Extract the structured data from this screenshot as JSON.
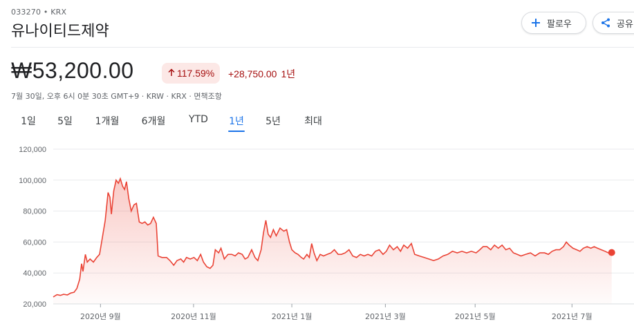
{
  "header": {
    "ticker": "033270 • KRX",
    "company": "유나이티드제약",
    "follow_label": "팔로우",
    "share_label": "공유"
  },
  "quote": {
    "price": "₩53,200.00",
    "change_pct": "117.59%",
    "change_abs": "+28,750.00",
    "change_period": "1년",
    "meta": "7월 30일, 오후 6시 0분 30초 GMT+9 · KRW · KRX · 면책조항"
  },
  "tabs": [
    {
      "label": "1일"
    },
    {
      "label": "5일"
    },
    {
      "label": "1개월"
    },
    {
      "label": "6개월"
    },
    {
      "label": "YTD"
    },
    {
      "label": "1년",
      "active": true
    },
    {
      "label": "5년"
    },
    {
      "label": "최대"
    }
  ],
  "colors": {
    "line": "#ea4335",
    "positive_bg": "#fce8e6",
    "positive_text": "#a50e0e",
    "accent": "#1a73e8"
  },
  "icons": {
    "follow": "plus-icon",
    "share": "share-icon"
  },
  "chart_data": {
    "type": "area",
    "x_range": [
      0,
      12
    ],
    "ylim": [
      20000,
      120000
    ],
    "yticks": [
      20000,
      40000,
      60000,
      80000,
      100000,
      120000
    ],
    "ytick_labels": [
      "20,000",
      "40,000",
      "60,000",
      "80,000",
      "100,000",
      "120,000"
    ],
    "xticks": [
      {
        "x": 1.0,
        "label": "2020년 9월"
      },
      {
        "x": 2.97,
        "label": "2020년 11월"
      },
      {
        "x": 5.05,
        "label": "2021년 1월"
      },
      {
        "x": 7.03,
        "label": "2021년 3월"
      },
      {
        "x": 8.93,
        "label": "2021년 5월"
      },
      {
        "x": 10.98,
        "label": "2021년 7월"
      }
    ],
    "points": [
      [
        0.0,
        24500
      ],
      [
        0.08,
        26000
      ],
      [
        0.15,
        25500
      ],
      [
        0.22,
        26200
      ],
      [
        0.3,
        25800
      ],
      [
        0.37,
        27000
      ],
      [
        0.44,
        27500
      ],
      [
        0.5,
        30000
      ],
      [
        0.56,
        36000
      ],
      [
        0.6,
        46000
      ],
      [
        0.63,
        41000
      ],
      [
        0.68,
        52000
      ],
      [
        0.72,
        47000
      ],
      [
        0.78,
        49000
      ],
      [
        0.85,
        47000
      ],
      [
        0.92,
        50000
      ],
      [
        0.98,
        52000
      ],
      [
        1.04,
        63000
      ],
      [
        1.1,
        74000
      ],
      [
        1.16,
        92000
      ],
      [
        1.2,
        89000
      ],
      [
        1.23,
        78000
      ],
      [
        1.28,
        93000
      ],
      [
        1.33,
        100000
      ],
      [
        1.38,
        98000
      ],
      [
        1.42,
        101000
      ],
      [
        1.47,
        96000
      ],
      [
        1.51,
        94000
      ],
      [
        1.55,
        99000
      ],
      [
        1.6,
        88000
      ],
      [
        1.65,
        80000
      ],
      [
        1.71,
        84000
      ],
      [
        1.76,
        85000
      ],
      [
        1.82,
        73000
      ],
      [
        1.88,
        72000
      ],
      [
        1.94,
        73000
      ],
      [
        2.0,
        71000
      ],
      [
        2.06,
        72000
      ],
      [
        2.12,
        76000
      ],
      [
        2.18,
        72000
      ],
      [
        2.22,
        51000
      ],
      [
        2.3,
        50000
      ],
      [
        2.4,
        50000
      ],
      [
        2.47,
        48000
      ],
      [
        2.55,
        45000
      ],
      [
        2.62,
        48000
      ],
      [
        2.7,
        49000
      ],
      [
        2.76,
        47000
      ],
      [
        2.82,
        50000
      ],
      [
        2.9,
        49000
      ],
      [
        2.98,
        50000
      ],
      [
        3.05,
        48000
      ],
      [
        3.12,
        52000
      ],
      [
        3.18,
        47000
      ],
      [
        3.25,
        44000
      ],
      [
        3.32,
        43000
      ],
      [
        3.38,
        45000
      ],
      [
        3.43,
        55000
      ],
      [
        3.5,
        53000
      ],
      [
        3.55,
        56000
      ],
      [
        3.62,
        49000
      ],
      [
        3.7,
        52000
      ],
      [
        3.78,
        52000
      ],
      [
        3.85,
        51000
      ],
      [
        3.92,
        53000
      ],
      [
        4.0,
        52000
      ],
      [
        4.06,
        49000
      ],
      [
        4.12,
        50000
      ],
      [
        4.2,
        55000
      ],
      [
        4.27,
        50000
      ],
      [
        4.33,
        48000
      ],
      [
        4.4,
        55000
      ],
      [
        4.45,
        66000
      ],
      [
        4.5,
        74000
      ],
      [
        4.55,
        65000
      ],
      [
        4.6,
        63000
      ],
      [
        4.66,
        68000
      ],
      [
        4.72,
        64000
      ],
      [
        4.8,
        69000
      ],
      [
        4.88,
        67000
      ],
      [
        4.94,
        68000
      ],
      [
        5.0,
        60000
      ],
      [
        5.05,
        55000
      ],
      [
        5.12,
        53000
      ],
      [
        5.18,
        52000
      ],
      [
        5.25,
        50000
      ],
      [
        5.3,
        49000
      ],
      [
        5.37,
        52000
      ],
      [
        5.42,
        50000
      ],
      [
        5.47,
        59000
      ],
      [
        5.52,
        53000
      ],
      [
        5.58,
        48000
      ],
      [
        5.65,
        52000
      ],
      [
        5.72,
        51000
      ],
      [
        5.8,
        52000
      ],
      [
        5.88,
        53000
      ],
      [
        5.95,
        55000
      ],
      [
        6.03,
        52000
      ],
      [
        6.1,
        52000
      ],
      [
        6.18,
        53000
      ],
      [
        6.26,
        55000
      ],
      [
        6.34,
        51000
      ],
      [
        6.42,
        50000
      ],
      [
        6.5,
        52000
      ],
      [
        6.58,
        51000
      ],
      [
        6.66,
        52000
      ],
      [
        6.74,
        51000
      ],
      [
        6.82,
        54000
      ],
      [
        6.9,
        55000
      ],
      [
        6.98,
        52000
      ],
      [
        7.05,
        54000
      ],
      [
        7.12,
        58000
      ],
      [
        7.2,
        55000
      ],
      [
        7.28,
        57000
      ],
      [
        7.35,
        54000
      ],
      [
        7.42,
        58000
      ],
      [
        7.5,
        56000
      ],
      [
        7.58,
        59000
      ],
      [
        7.65,
        52000
      ],
      [
        7.75,
        51000
      ],
      [
        7.85,
        50000
      ],
      [
        7.95,
        49000
      ],
      [
        8.05,
        48000
      ],
      [
        8.15,
        49000
      ],
      [
        8.25,
        51000
      ],
      [
        8.35,
        52000
      ],
      [
        8.45,
        54000
      ],
      [
        8.55,
        53000
      ],
      [
        8.65,
        54000
      ],
      [
        8.75,
        53000
      ],
      [
        8.85,
        54000
      ],
      [
        8.95,
        53000
      ],
      [
        9.03,
        55000
      ],
      [
        9.1,
        57000
      ],
      [
        9.18,
        57000
      ],
      [
        9.26,
        55000
      ],
      [
        9.34,
        58000
      ],
      [
        9.42,
        56000
      ],
      [
        9.5,
        58000
      ],
      [
        9.58,
        55000
      ],
      [
        9.66,
        56000
      ],
      [
        9.74,
        53000
      ],
      [
        9.82,
        52000
      ],
      [
        9.9,
        51000
      ],
      [
        10.0,
        52000
      ],
      [
        10.1,
        53000
      ],
      [
        10.2,
        51000
      ],
      [
        10.3,
        53000
      ],
      [
        10.4,
        53000
      ],
      [
        10.48,
        52000
      ],
      [
        10.56,
        54000
      ],
      [
        10.64,
        55000
      ],
      [
        10.72,
        55000
      ],
      [
        10.8,
        57000
      ],
      [
        10.86,
        60000
      ],
      [
        10.92,
        58000
      ],
      [
        11.0,
        56000
      ],
      [
        11.08,
        55000
      ],
      [
        11.15,
        54000
      ],
      [
        11.22,
        56000
      ],
      [
        11.3,
        57000
      ],
      [
        11.38,
        56000
      ],
      [
        11.45,
        57000
      ],
      [
        11.52,
        56000
      ],
      [
        11.6,
        55000
      ],
      [
        11.68,
        54000
      ],
      [
        11.75,
        53000
      ],
      [
        11.82,
        53200
      ]
    ]
  }
}
